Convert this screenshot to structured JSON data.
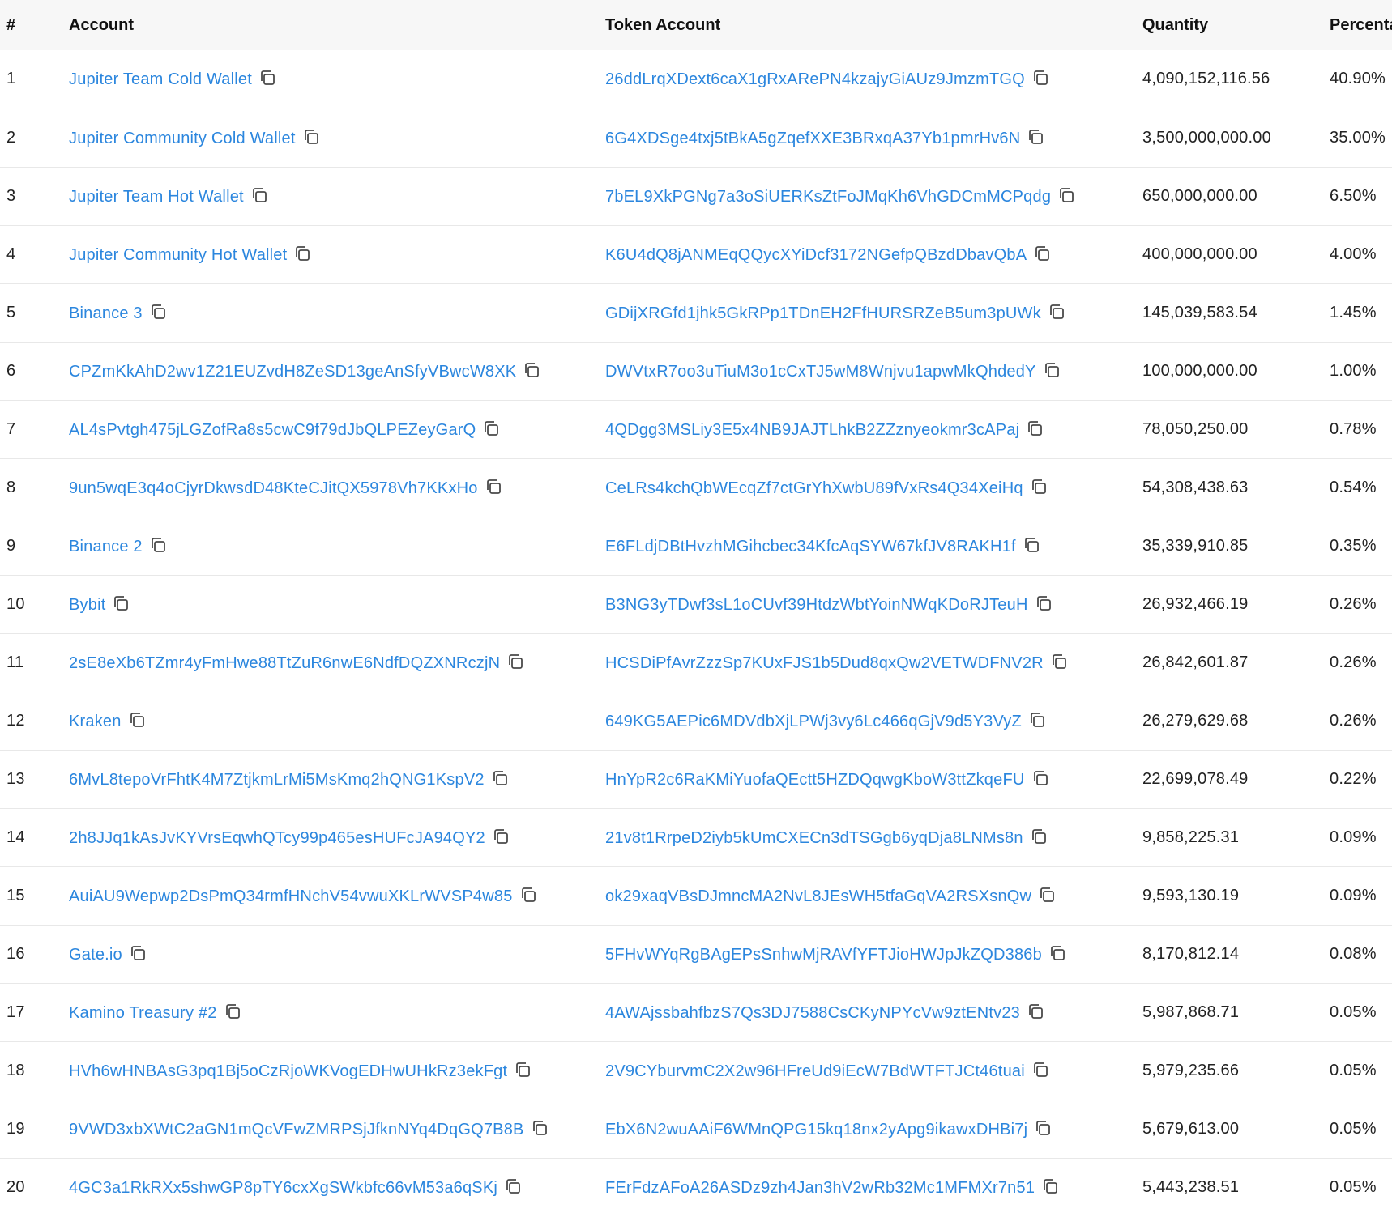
{
  "columns": {
    "rank": "#",
    "account": "Account",
    "token_account": "Token Account",
    "quantity": "Quantity",
    "percentage": "Percentage"
  },
  "rows": [
    {
      "rank": "1",
      "account": "Jupiter Team Cold Wallet",
      "token_account": "26ddLrqXDext6caX1gRxARePN4kzajyGiAUz9JmzmTGQ",
      "quantity": "4,090,152,116.56",
      "percentage": "40.90%"
    },
    {
      "rank": "2",
      "account": "Jupiter Community Cold Wallet",
      "token_account": "6G4XDSge4txj5tBkA5gZqefXXE3BRxqA37Yb1pmrHv6N",
      "quantity": "3,500,000,000.00",
      "percentage": "35.00%"
    },
    {
      "rank": "3",
      "account": "Jupiter Team Hot Wallet",
      "token_account": "7bEL9XkPGNg7a3oSiUERKsZtFoJMqKh6VhGDCmMCPqdg",
      "quantity": "650,000,000.00",
      "percentage": "6.50%"
    },
    {
      "rank": "4",
      "account": "Jupiter Community Hot Wallet",
      "token_account": "K6U4dQ8jANMEqQQycXYiDcf3172NGefpQBzdDbavQbA",
      "quantity": "400,000,000.00",
      "percentage": "4.00%"
    },
    {
      "rank": "5",
      "account": "Binance 3",
      "token_account": "GDijXRGfd1jhk5GkRPp1TDnEH2FfHURSRZeB5um3pUWk",
      "quantity": "145,039,583.54",
      "percentage": "1.45%"
    },
    {
      "rank": "6",
      "account": "CPZmKkAhD2wv1Z21EUZvdH8ZeSD13geAnSfyVBwcW8XK",
      "token_account": "DWVtxR7oo3uTiuM3o1cCxTJ5wM8Wnjvu1apwMkQhdedY",
      "quantity": "100,000,000.00",
      "percentage": "1.00%"
    },
    {
      "rank": "7",
      "account": "AL4sPvtgh475jLGZofRa8s5cwC9f79dJbQLPEZeyGarQ",
      "token_account": "4QDgg3MSLiy3E5x4NB9JAJTLhkB2ZZznyeokmr3cAPaj",
      "quantity": "78,050,250.00",
      "percentage": "0.78%"
    },
    {
      "rank": "8",
      "account": "9un5wqE3q4oCjyrDkwsdD48KteCJitQX5978Vh7KKxHo",
      "token_account": "CeLRs4kchQbWEcqZf7ctGrYhXwbU89fVxRs4Q34XeiHq",
      "quantity": "54,308,438.63",
      "percentage": "0.54%"
    },
    {
      "rank": "9",
      "account": "Binance 2",
      "token_account": "E6FLdjDBtHvzhMGihcbec34KfcAqSYW67kfJV8RAKH1f",
      "quantity": "35,339,910.85",
      "percentage": "0.35%"
    },
    {
      "rank": "10",
      "account": "Bybit",
      "token_account": "B3NG3yTDwf3sL1oCUvf39HtdzWbtYoinNWqKDoRJTeuH",
      "quantity": "26,932,466.19",
      "percentage": "0.26%"
    },
    {
      "rank": "11",
      "account": "2sE8eXb6TZmr4yFmHwe88TtZuR6nwE6NdfDQZXNRczjN",
      "token_account": "HCSDiPfAvrZzzSp7KUxFJS1b5Dud8qxQw2VETWDFNV2R",
      "quantity": "26,842,601.87",
      "percentage": "0.26%"
    },
    {
      "rank": "12",
      "account": "Kraken",
      "token_account": "649KG5AEPic6MDVdbXjLPWj3vy6Lc466qGjV9d5Y3VyZ",
      "quantity": "26,279,629.68",
      "percentage": "0.26%"
    },
    {
      "rank": "13",
      "account": "6MvL8tepoVrFhtK4M7ZtjkmLrMi5MsKmq2hQNG1KspV2",
      "token_account": "HnYpR2c6RaKMiYuofaQEctt5HZDQqwgKboW3ttZkqeFU",
      "quantity": "22,699,078.49",
      "percentage": "0.22%"
    },
    {
      "rank": "14",
      "account": "2h8JJq1kAsJvKYVrsEqwhQTcy99p465esHUFcJA94QY2",
      "token_account": "21v8t1RrpeD2iyb5kUmCXECn3dTSGgb6yqDja8LNMs8n",
      "quantity": "9,858,225.31",
      "percentage": "0.09%"
    },
    {
      "rank": "15",
      "account": "AuiAU9Wepwp2DsPmQ34rmfHNchV54vwuXKLrWVSP4w85",
      "token_account": "ok29xaqVBsDJmncMA2NvL8JEsWH5tfaGqVA2RSXsnQw",
      "quantity": "9,593,130.19",
      "percentage": "0.09%"
    },
    {
      "rank": "16",
      "account": "Gate.io",
      "token_account": "5FHvWYqRgBAgEPsSnhwMjRAVfYFTJioHWJpJkZQD386b",
      "quantity": "8,170,812.14",
      "percentage": "0.08%"
    },
    {
      "rank": "17",
      "account": "Kamino Treasury #2",
      "token_account": "4AWAjssbahfbzS7Qs3DJ7588CsCKyNPYcVw9ztENtv23",
      "quantity": "5,987,868.71",
      "percentage": "0.05%"
    },
    {
      "rank": "18",
      "account": "HVh6wHNBAsG3pq1Bj5oCzRjoWKVogEDHwUHkRz3ekFgt",
      "token_account": "2V9CYburvmC2X2w96HFreUd9iEcW7BdWTFTJCt46tuai",
      "quantity": "5,979,235.66",
      "percentage": "0.05%"
    },
    {
      "rank": "19",
      "account": "9VWD3xbXWtC2aGN1mQcVFwZMRPSjJfknNYq4DqGQ7B8B",
      "token_account": "EbX6N2wuAAiF6WMnQPG15kq18nx2yApg9ikawxDHBi7j",
      "quantity": "5,679,613.00",
      "percentage": "0.05%"
    },
    {
      "rank": "20",
      "account": "4GC3a1RkRXx5shwGP8pTY6cxXgSWkbfc66vM53a6qSKj",
      "token_account": "FErFdzAFoA26ASDz9zh4Jan3hV2wRb32Mc1MFMXr7n51",
      "quantity": "5,443,238.51",
      "percentage": "0.05%"
    }
  ],
  "icons": {
    "copy": "copy-icon"
  },
  "colors": {
    "link": "#2b86de",
    "header_bg": "#f7f7f7",
    "divider": "#e8e8e8"
  }
}
